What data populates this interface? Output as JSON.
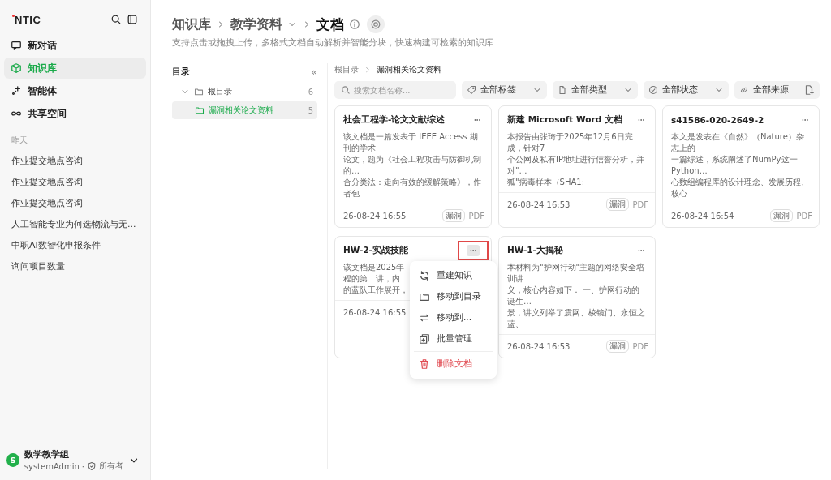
{
  "sidebar": {
    "logo": "NTIC",
    "nav": [
      {
        "label": "新对话",
        "selected": false
      },
      {
        "label": "知识库",
        "selected": true
      },
      {
        "label": "智能体",
        "selected": false
      },
      {
        "label": "共享空间",
        "selected": false
      }
    ],
    "history_heading": "昨天",
    "history": [
      "作业提交地点咨询",
      "作业提交地点咨询",
      "作业提交地点咨询",
      "人工智能专业为何选物流与无...",
      "中职AI数智化申报条件",
      "询问项目数量"
    ],
    "user": {
      "avatar": "S",
      "name": "数学教学组",
      "account": "systemAdmin",
      "separator": "·",
      "role": "所有者"
    }
  },
  "header": {
    "breadcrumb": [
      "知识库",
      "教学资料",
      "文档"
    ],
    "subtitle": "支持点击或拖拽上传，多格式文档自动解析并智能分块，快速构建可检索的知识库"
  },
  "directory": {
    "title": "目录",
    "collapse": "«",
    "tree": [
      {
        "label": "根目录",
        "count": "6",
        "expanded": true,
        "selected": false,
        "children": [
          {
            "label": "漏洞相关论文资料",
            "count": "5",
            "selected": true
          }
        ]
      }
    ]
  },
  "path": [
    "根目录",
    "漏洞相关论文资料"
  ],
  "search": {
    "placeholder": "搜索文档名称..."
  },
  "filters": [
    {
      "label": "全部标签"
    },
    {
      "label": "全部类型"
    },
    {
      "label": "全部状态"
    },
    {
      "label": "全部来源"
    }
  ],
  "cards": [
    {
      "title": "社会工程学-论文文献综述",
      "lines": [
        "该文档是一篇发表于 IEEE Access 期刊的学术",
        "论文，题为《社会工程攻击与防御机制的…",
        "合分类法：走向有效的缓解策略》，作者包"
      ],
      "date": "26-08-24 16:55",
      "tag": "漏洞",
      "type": "PDF",
      "menu_open": false
    },
    {
      "title": "新建 Microsoft Word 文档",
      "lines": [
        "本报告由张琦于2025年12月6日完成，针对7",
        "个公网及私有IP地址进行信誉分析，并对\"…",
        "狐\"病毒样本（SHA1:"
      ],
      "date": "26-08-24 16:53",
      "tag": "漏洞",
      "type": "PDF",
      "menu_open": false
    },
    {
      "title": "s41586-020-2649-2",
      "lines": [
        "本文是发表在《自然》（Nature）杂志上的",
        "一篇综述，系统阐述了NumPy这一Python…",
        "心数组编程库的设计理念、发展历程、核心"
      ],
      "date": "26-08-24 16:54",
      "tag": "漏洞",
      "type": "PDF",
      "menu_open": false
    },
    {
      "title": "HW-2-实战技能",
      "lines": [
        "该文档是2025年",
        "程的第二讲，内",
        "的蓝队工作展开，"
      ],
      "date": "26-08-24 16:55",
      "menu_open": true
    },
    {
      "title": "HW-1-大揭秘",
      "lines": [
        "本材料为\"护网行动\"主题的网络安全培训讲",
        "义，核心内容如下： 一、护网行动的诞生…",
        "景，讲义列举了震网、棱镜门、永恒之蓝、"
      ],
      "date": "26-08-24 16:53",
      "tag": "漏洞",
      "type": "PDF",
      "menu_open": false
    }
  ],
  "menu": [
    {
      "label": "重建知识",
      "kind": "normal"
    },
    {
      "label": "移动到目录",
      "kind": "normal"
    },
    {
      "label": "移动到...",
      "kind": "normal"
    },
    {
      "label": "批量管理",
      "kind": "normal"
    },
    {
      "label": "删除文档",
      "kind": "danger"
    }
  ]
}
